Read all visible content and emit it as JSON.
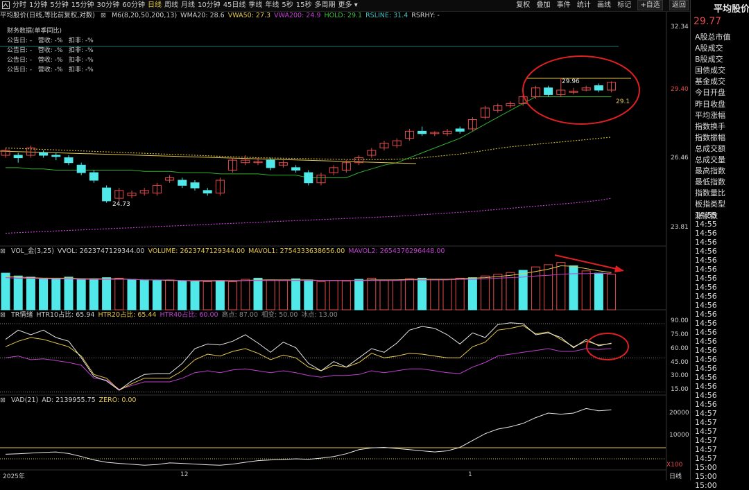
{
  "toolbar": {
    "tabs": [
      "分时",
      "1分钟",
      "5分钟",
      "15分钟",
      "30分钟",
      "60分钟",
      "日线",
      "周线",
      "月线",
      "10分钟",
      "45日线",
      "季线",
      "年线",
      "5秒",
      "15秒",
      "多周期",
      "更多"
    ],
    "active": "日线",
    "tools": [
      "复权",
      "叠加",
      "事件",
      "统计",
      "画线",
      "标记"
    ],
    "self_select": "+自选",
    "back": "返回"
  },
  "right_panel": {
    "title": "平均股价",
    "price": "29.77",
    "items": [
      "A股总市值",
      "A股成交",
      "B股成交",
      "国债成交",
      "基金成交",
      "今日开盘",
      "昨日收盘",
      "平均涨幅",
      "指数换手",
      "指数振幅",
      "总成交额",
      "总成交量",
      "最高指数",
      "最低指数",
      "指数量比",
      "板指类型",
      "涨家数"
    ],
    "times": [
      "14:55",
      "14:55",
      "14:56",
      "14:56",
      "14:56",
      "14:56",
      "14:56",
      "14:56",
      "14:56",
      "14:56",
      "14:56",
      "14:56",
      "14:56",
      "14:56",
      "14:56",
      "14:56",
      "14:56",
      "14:56",
      "14:56",
      "14:56",
      "14:56",
      "14:56",
      "14:57",
      "14:57",
      "14:57",
      "14:57",
      "14:57",
      "14:57",
      "15:00",
      "15:00",
      "15:00"
    ]
  },
  "price_panel": {
    "title": "平均股价(日线,等比前复权,对数)",
    "indicators": [
      {
        "label": "M6(8,20,50,200,13)",
        "color": "#cfcfcf"
      },
      {
        "label": "WMA20: 28.6",
        "color": "#cfcfcf"
      },
      {
        "label": "VWA50: 27.3",
        "color": "#e6c84a"
      },
      {
        "label": "VWA200: 24.9",
        "color": "#c040d0"
      },
      {
        "label": "HOLD: 29.1",
        "color": "#40c040"
      },
      {
        "label": "RSLINE: 31.4",
        "color": "#40c0c0"
      },
      {
        "label": "RSRHY: -",
        "color": "#cfcfcf"
      }
    ],
    "financial": {
      "title": "财务数据(单季同比)",
      "rows": [
        "公告日: -   营收: -%   扣非: -%",
        "公告日: -   营收: -%   扣非: -%",
        "公告日: -   营收: -%   扣非: -%",
        "公告日: -   营收: -%   扣非: -%"
      ]
    },
    "y_labels": [
      "32.34",
      "29.40",
      "26.46",
      "23.81"
    ],
    "high_label": "29.96",
    "low_label": "24.73",
    "hold_label": "29.1"
  },
  "volume_panel": {
    "indicators": [
      {
        "label": "VOL_金(3,25)",
        "color": "#cfcfcf"
      },
      {
        "label": "VVOL: 2623747129344.00",
        "color": "#cfcfcf"
      },
      {
        "label": "VOLUME: 2623747129344.00",
        "color": "#e6c84a"
      },
      {
        "label": "MAVOL1: 2754333638656.00",
        "color": "#e6c84a"
      },
      {
        "label": "MAVOL2: 2654376296448.00",
        "color": "#c040d0"
      }
    ]
  },
  "tr_panel": {
    "indicators": [
      {
        "label": "TR情绪",
        "color": "#cfcfcf"
      },
      {
        "label": "HTR10占比: 65.94",
        "color": "#cfcfcf"
      },
      {
        "label": "HTR20占比: 65.44",
        "color": "#e6c84a"
      },
      {
        "label": "HTR40占比: 60.00",
        "color": "#c040d0"
      },
      {
        "label": "高点: 87.00",
        "color": "#888888"
      },
      {
        "label": "相变: 50.00",
        "color": "#888888"
      },
      {
        "label": "冰点: 13.00",
        "color": "#888888"
      }
    ],
    "y_labels": [
      "90.00",
      "75.00",
      "60.00",
      "45.00",
      "30.00",
      "15.00"
    ]
  },
  "vad_panel": {
    "indicators": [
      {
        "label": "VAD(21)",
        "color": "#cfcfcf"
      },
      {
        "label": "AD: 2139955.75",
        "color": "#cfcfcf"
      },
      {
        "label": "ZERO: 0.00",
        "color": "#e6c84a"
      }
    ],
    "y_labels": [
      "20000",
      "10000"
    ],
    "unit": "X100"
  },
  "x_axis": {
    "labels": [
      "2025年",
      "12",
      "1"
    ],
    "period": "日线"
  },
  "chart_data": {
    "type": "candlestick",
    "candles": [
      {
        "o": 26.6,
        "c": 26.8,
        "h": 26.9,
        "l": 26.5
      },
      {
        "o": 26.6,
        "c": 26.5,
        "h": 26.7,
        "l": 26.3
      },
      {
        "o": 26.6,
        "c": 26.9,
        "h": 27.0,
        "l": 26.5
      },
      {
        "o": 26.7,
        "c": 26.6,
        "h": 26.8,
        "l": 26.5
      },
      {
        "o": 26.6,
        "c": 26.55,
        "h": 26.7,
        "l": 26.4
      },
      {
        "o": 26.5,
        "c": 26.3,
        "h": 26.6,
        "l": 26.2
      },
      {
        "o": 26.2,
        "c": 25.9,
        "h": 26.3,
        "l": 25.8
      },
      {
        "o": 25.9,
        "c": 25.6,
        "h": 26.0,
        "l": 25.5
      },
      {
        "o": 25.3,
        "c": 24.8,
        "h": 25.4,
        "l": 24.73
      },
      {
        "o": 24.9,
        "c": 25.2,
        "h": 25.3,
        "l": 24.8
      },
      {
        "o": 25.0,
        "c": 25.1,
        "h": 25.2,
        "l": 24.9
      },
      {
        "o": 25.1,
        "c": 25.2,
        "h": 25.3,
        "l": 25.0
      },
      {
        "o": 25.1,
        "c": 25.4,
        "h": 25.5,
        "l": 25.0
      },
      {
        "o": 25.6,
        "c": 25.7,
        "h": 25.8,
        "l": 25.5
      },
      {
        "o": 25.6,
        "c": 25.4,
        "h": 25.7,
        "l": 25.3
      },
      {
        "o": 25.5,
        "c": 25.3,
        "h": 25.6,
        "l": 25.2
      },
      {
        "o": 25.2,
        "c": 25.1,
        "h": 25.3,
        "l": 25.0
      },
      {
        "o": 25.1,
        "c": 25.6,
        "h": 25.7,
        "l": 25.0
      },
      {
        "o": 26.0,
        "c": 26.4,
        "h": 26.5,
        "l": 25.9
      },
      {
        "o": 26.3,
        "c": 26.4,
        "h": 26.6,
        "l": 26.2
      },
      {
        "o": 26.3,
        "c": 26.35,
        "h": 26.5,
        "l": 26.2
      },
      {
        "o": 26.4,
        "c": 26.1,
        "h": 26.5,
        "l": 26.0
      },
      {
        "o": 26.2,
        "c": 26.3,
        "h": 26.4,
        "l": 26.1
      },
      {
        "o": 26.1,
        "c": 26.0,
        "h": 26.2,
        "l": 25.9
      },
      {
        "o": 25.9,
        "c": 25.5,
        "h": 26.0,
        "l": 25.4
      },
      {
        "o": 25.5,
        "c": 25.8,
        "h": 25.9,
        "l": 25.4
      },
      {
        "o": 25.9,
        "c": 26.1,
        "h": 26.2,
        "l": 25.8
      },
      {
        "o": 26.0,
        "c": 26.3,
        "h": 26.4,
        "l": 25.9
      },
      {
        "o": 26.3,
        "c": 26.5,
        "h": 26.6,
        "l": 26.2
      },
      {
        "o": 26.6,
        "c": 26.8,
        "h": 26.9,
        "l": 26.5
      },
      {
        "o": 26.9,
        "c": 27.1,
        "h": 27.2,
        "l": 26.8
      },
      {
        "o": 27.0,
        "c": 27.2,
        "h": 27.3,
        "l": 26.9
      },
      {
        "o": 27.3,
        "c": 27.6,
        "h": 27.7,
        "l": 27.2
      },
      {
        "o": 27.6,
        "c": 27.5,
        "h": 27.8,
        "l": 27.4
      },
      {
        "o": 27.5,
        "c": 27.55,
        "h": 27.6,
        "l": 27.4
      },
      {
        "o": 27.5,
        "c": 27.6,
        "h": 27.7,
        "l": 27.4
      },
      {
        "o": 27.7,
        "c": 27.6,
        "h": 27.8,
        "l": 27.5
      },
      {
        "o": 27.7,
        "c": 28.1,
        "h": 28.2,
        "l": 27.6
      },
      {
        "o": 28.2,
        "c": 28.6,
        "h": 28.7,
        "l": 28.1
      },
      {
        "o": 28.5,
        "c": 28.7,
        "h": 28.8,
        "l": 28.4
      },
      {
        "o": 28.7,
        "c": 28.8,
        "h": 28.9,
        "l": 28.6
      },
      {
        "o": 28.8,
        "c": 29.1,
        "h": 29.2,
        "l": 28.7
      },
      {
        "o": 29.1,
        "c": 29.5,
        "h": 29.6,
        "l": 29.0
      },
      {
        "o": 29.5,
        "c": 29.2,
        "h": 29.6,
        "l": 29.1
      },
      {
        "o": 29.2,
        "c": 29.4,
        "h": 29.96,
        "l": 29.1
      },
      {
        "o": 29.3,
        "c": 29.35,
        "h": 29.5,
        "l": 29.2
      },
      {
        "o": 29.4,
        "c": 29.5,
        "h": 29.6,
        "l": 29.35
      },
      {
        "o": 29.6,
        "c": 29.4,
        "h": 29.7,
        "l": 29.3
      },
      {
        "o": 29.4,
        "c": 29.75,
        "h": 29.8,
        "l": 29.3
      }
    ],
    "hold_line": [
      26.1,
      26.1,
      26.05,
      26.05,
      26.0,
      26.0,
      26.0,
      26.0,
      26.0,
      26.0,
      26.0,
      25.95,
      25.95,
      25.95,
      25.9,
      25.9,
      25.9,
      25.85,
      25.85,
      25.85,
      25.85,
      25.8,
      25.8,
      25.8,
      25.7,
      25.7,
      25.7,
      25.7,
      25.9,
      26.05,
      26.2,
      26.3,
      26.5,
      26.7,
      26.9,
      27.1,
      27.3,
      27.6,
      27.9,
      28.2,
      28.5,
      28.8,
      29.1,
      29.1,
      29.1,
      29.1,
      29.1,
      29.1,
      29.1
    ],
    "vwa50": [
      26.9,
      26.88,
      26.86,
      26.84,
      26.82,
      26.8,
      26.78,
      26.76,
      26.74,
      26.72,
      26.7,
      26.68,
      26.66,
      26.64,
      26.62,
      26.6,
      26.58,
      26.56,
      26.54,
      26.52,
      26.5,
      26.49,
      26.48,
      26.47,
      26.46,
      26.45,
      26.44,
      26.43,
      26.43,
      26.43,
      26.43,
      26.44,
      26.46,
      26.5,
      26.55,
      26.6,
      26.65,
      26.72,
      26.8,
      26.88,
      26.95,
      27.0,
      27.05,
      27.1,
      27.15,
      27.2,
      27.25,
      27.3,
      27.35
    ],
    "vwa200": [
      23.6,
      23.62,
      23.64,
      23.66,
      23.68,
      23.7,
      23.72,
      23.74,
      23.76,
      23.78,
      23.8,
      23.82,
      23.84,
      23.86,
      23.88,
      23.9,
      23.92,
      23.94,
      23.96,
      23.98,
      24.0,
      24.02,
      24.04,
      24.06,
      24.08,
      24.1,
      24.12,
      24.14,
      24.16,
      24.18,
      24.2,
      24.22,
      24.25,
      24.28,
      24.31,
      24.34,
      24.37,
      24.4,
      24.44,
      24.48,
      24.52,
      24.56,
      24.6,
      24.64,
      24.68,
      24.72,
      24.77,
      24.82,
      24.9
    ],
    "volume": [
      6.5,
      6.0,
      5.8,
      5.6,
      5.5,
      5.8,
      5.5,
      5.5,
      5.7,
      5.6,
      5.4,
      5.3,
      5.2,
      5.3,
      5.1,
      5.0,
      5.0,
      5.2,
      5.0,
      5.4,
      5.6,
      5.3,
      5.2,
      5.5,
      5.3,
      5.0,
      5.2,
      5.1,
      5.4,
      5.6,
      5.2,
      5.3,
      5.5,
      5.6,
      5.3,
      5.4,
      5.6,
      5.7,
      6.0,
      6.3,
      6.6,
      7.0,
      7.6,
      8.0,
      8.4,
      7.8,
      6.9,
      6.5,
      6.3
    ],
    "mavol1": [
      5.9,
      5.8,
      5.7,
      5.6,
      5.6,
      5.6,
      5.5,
      5.5,
      5.5,
      5.5,
      5.4,
      5.3,
      5.3,
      5.2,
      5.2,
      5.1,
      5.1,
      5.1,
      5.1,
      5.2,
      5.3,
      5.3,
      5.3,
      5.3,
      5.3,
      5.2,
      5.2,
      5.2,
      5.2,
      5.3,
      5.3,
      5.3,
      5.4,
      5.4,
      5.4,
      5.4,
      5.5,
      5.6,
      5.7,
      5.9,
      6.1,
      6.4,
      6.8,
      7.2,
      7.8,
      7.7,
      7.3,
      6.9,
      6.6
    ],
    "mavol2": [
      5.7,
      5.6,
      5.6,
      5.5,
      5.5,
      5.5,
      5.4,
      5.4,
      5.4,
      5.4,
      5.4,
      5.3,
      5.3,
      5.3,
      5.2,
      5.2,
      5.2,
      5.2,
      5.2,
      5.2,
      5.2,
      5.2,
      5.2,
      5.2,
      5.2,
      5.2,
      5.2,
      5.2,
      5.2,
      5.2,
      5.2,
      5.2,
      5.3,
      5.3,
      5.3,
      5.3,
      5.4,
      5.4,
      5.5,
      5.6,
      5.7,
      5.8,
      6.0,
      6.1,
      6.3,
      6.4,
      6.4,
      6.5,
      6.4
    ],
    "vol_cyan": [
      0,
      1,
      2,
      3,
      4,
      5,
      6,
      7,
      8,
      10,
      11,
      12,
      14,
      15,
      17,
      20,
      23,
      24,
      28,
      33,
      37,
      41,
      45,
      47
    ],
    "htr10": [
      70,
      80,
      75,
      80,
      72,
      68,
      50,
      30,
      25,
      15,
      25,
      32,
      33,
      33,
      44,
      60,
      65,
      64,
      68,
      75,
      66,
      56,
      67,
      61,
      44,
      36,
      46,
      40,
      50,
      60,
      56,
      66,
      80,
      84,
      82,
      75,
      65,
      77,
      72,
      86,
      88,
      87,
      75,
      77,
      72,
      61,
      70,
      63,
      65.94
    ],
    "htr20": [
      62,
      68,
      72,
      70,
      66,
      62,
      52,
      32,
      28,
      15,
      22,
      28,
      28,
      28,
      36,
      48,
      54,
      52,
      57,
      60,
      55,
      48,
      53,
      50,
      40,
      36,
      42,
      40,
      45,
      55,
      50,
      52,
      55,
      54,
      52,
      50,
      50,
      62,
      67,
      80,
      82,
      85,
      76,
      78,
      70,
      62,
      68,
      64,
      65.44
    ],
    "htr40": [
      50,
      52,
      48,
      49,
      47,
      45,
      42,
      28,
      26,
      16,
      20,
      24,
      24,
      24,
      28,
      34,
      36,
      34,
      37,
      38,
      36,
      34,
      36,
      34,
      31,
      29,
      31,
      31,
      32,
      36,
      34,
      36,
      38,
      38,
      36,
      34,
      33,
      40,
      45,
      52,
      54,
      56,
      58,
      60,
      57,
      57,
      60,
      59,
      60.0
    ],
    "vad": [
      2.0,
      2.2,
      2.5,
      2.8,
      3.0,
      2.3,
      1.0,
      -0.5,
      -1.5,
      -2.0,
      -2.4,
      -2.8,
      -2.5,
      -1.8,
      -2.0,
      -2.3,
      -2.6,
      -2.8,
      -2.3,
      -1.5,
      -0.8,
      -0.5,
      -0.3,
      0.0,
      -0.2,
      0.3,
      1.0,
      2.2,
      4.0,
      4.8,
      5.0,
      4.5,
      4.0,
      3.5,
      3.0,
      3.5,
      5.0,
      8.0,
      11.0,
      13.0,
      14.0,
      15.5,
      18.0,
      20.0,
      19.5,
      20.0,
      22.0,
      21.0,
      21.4
    ],
    "vad_zero": 0
  }
}
